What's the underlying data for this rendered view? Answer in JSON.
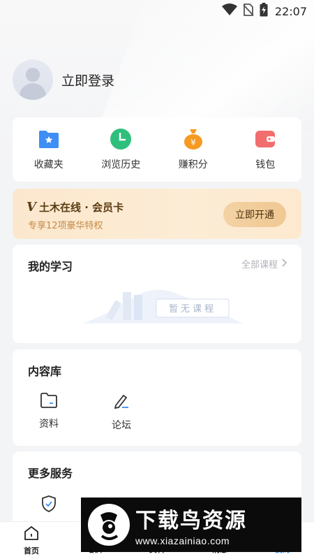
{
  "status_bar": {
    "time": "22:07",
    "icons": [
      "wifi-icon",
      "no-sim-icon",
      "battery-charging-icon"
    ]
  },
  "profile": {
    "login_label": "立即登录",
    "avatar_icon": "user-avatar-placeholder"
  },
  "quick_actions": [
    {
      "label": "收藏夹",
      "icon": "folder-star-icon",
      "color": "#3d8ef5"
    },
    {
      "label": "浏览历史",
      "icon": "clock-icon",
      "color": "#2fbf7d"
    },
    {
      "label": "赚积分",
      "icon": "money-bag-icon",
      "color": "#f59a23"
    },
    {
      "label": "钱包",
      "icon": "wallet-icon",
      "color": "#f26d6d"
    }
  ],
  "vip": {
    "badge": "VIP",
    "title": "土木在线 · 会员卡",
    "subtitle": "专享12项豪华特权",
    "button": "立即开通"
  },
  "my_study": {
    "title": "我的学习",
    "all_link": "全部课程",
    "empty_text": "暂无课程"
  },
  "content_library": {
    "title": "内容库",
    "items": [
      {
        "label": "资料",
        "icon": "folder-outline-icon"
      },
      {
        "label": "论坛",
        "icon": "pen-edit-icon"
      }
    ]
  },
  "more_services": {
    "title": "更多服务"
  },
  "tabs": [
    {
      "label": "首页",
      "icon": "home-icon"
    },
    {
      "label": "培训",
      "icon": "training-icon"
    },
    {
      "label": "资料",
      "icon": "docs-icon"
    },
    {
      "label": "消息",
      "icon": "message-icon"
    },
    {
      "label": "我的",
      "icon": "profile-icon",
      "active": true
    }
  ],
  "watermark": {
    "main": "下载鸟资源",
    "sub": "www.xiazainiao.com"
  },
  "colors": {
    "accent_active": "#3d8ef5",
    "vip_text": "#5a3c12",
    "vip_sub": "#c58a45"
  }
}
